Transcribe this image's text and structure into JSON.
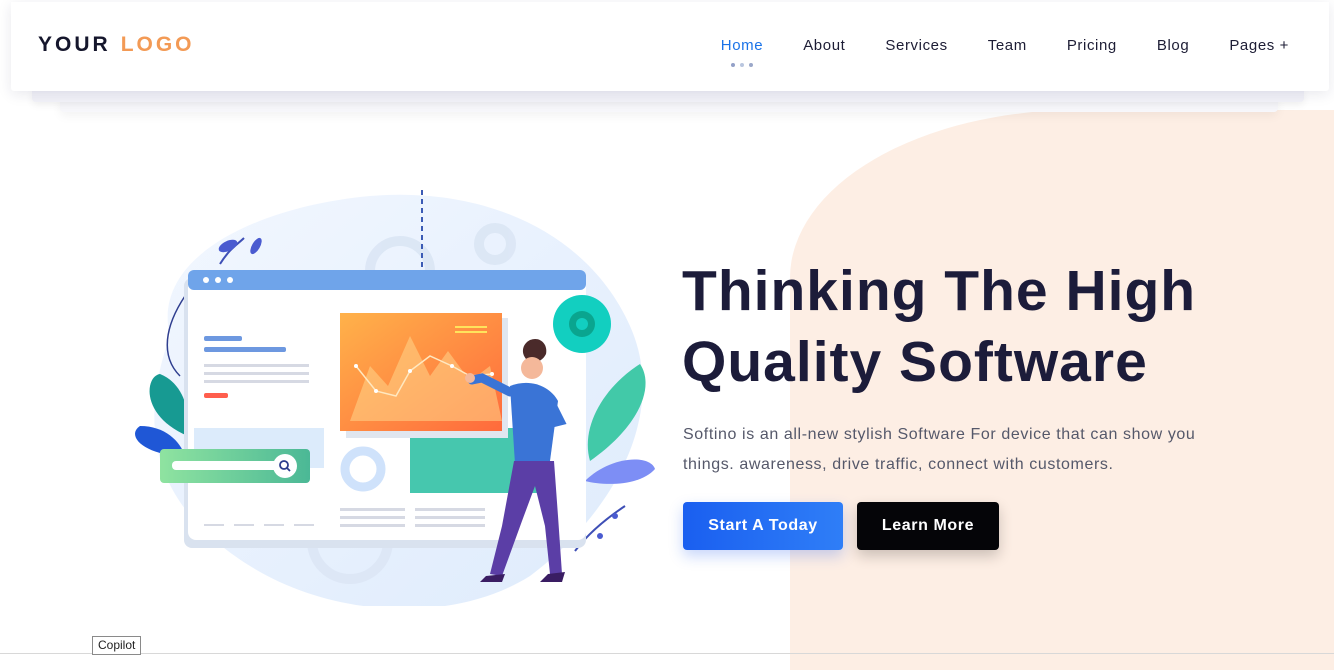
{
  "header": {
    "logo": {
      "part1": "YOUR",
      "part2": "LOGO"
    },
    "nav": [
      {
        "label": "Home",
        "active": true
      },
      {
        "label": "About"
      },
      {
        "label": "Services"
      },
      {
        "label": "Team"
      },
      {
        "label": "Pricing"
      },
      {
        "label": "Blog"
      },
      {
        "label": "Pages +"
      }
    ]
  },
  "hero": {
    "title_line1": "Thinking The High",
    "title_line2": "Quality Software",
    "description": "Softino is an all-new stylish Software For device that can show you things. awareness, drive traffic, connect with customers.",
    "primary_button": "Start A Today",
    "secondary_button": "Learn More"
  },
  "tooltip": {
    "label": "Copilot"
  },
  "colors": {
    "accent": "#1a73e8",
    "logo_accent": "#f39a55",
    "primary_button": "#1f66f2",
    "dark_button": "#050508",
    "title": "#1c1c3a",
    "peach_bg": "#fdeee4"
  },
  "icons": [
    "search-icon",
    "gear-icon",
    "menu-dots-icon",
    "leaf-icon"
  ]
}
